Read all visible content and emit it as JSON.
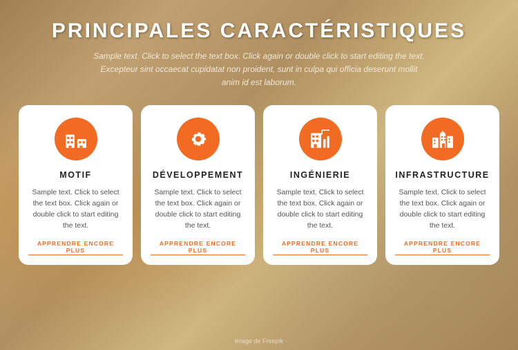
{
  "page": {
    "title": "PRINCIPALES CARACTÉRISTIQUES",
    "subtitle": "Sample text. Click to select the text box. Click again or double click to start editing the text. Excepteur sint occaecat cupidatat non proident, sunt in culpa qui officia deserunt mollit anim id est laborum.",
    "image_credit": "Image de Freepik"
  },
  "cards": [
    {
      "id": "motif",
      "icon": "motif",
      "title": "MOTIF",
      "text": "Sample text. Click to select the text box. Click again or double click to start editing the text.",
      "link": "APPRENDRE ENCORE PLUS"
    },
    {
      "id": "developpement",
      "icon": "gear",
      "title": "DÉVELOPPEMENT",
      "text": "Sample text. Click to select the text box. Click again or double click to start editing the text.",
      "link": "APPRENDRE ENCORE PLUS"
    },
    {
      "id": "ingenierie",
      "icon": "building-chart",
      "title": "INGÉNIERIE",
      "text": "Sample text. Click to select the text box. Click again or double click to start editing the text.",
      "link": "APPRENDRE ENCORE PLUS"
    },
    {
      "id": "infrastructure",
      "icon": "city",
      "title": "INFRASTRUCTURE",
      "text": "Sample text. Click to select the text box. Click again or double click to start editing the text.",
      "link": "APPRENDRE ENCORE PLUS"
    }
  ],
  "colors": {
    "accent": "#f26b22",
    "white": "#ffffff",
    "dark_text": "#222222",
    "muted_text": "#555555"
  }
}
